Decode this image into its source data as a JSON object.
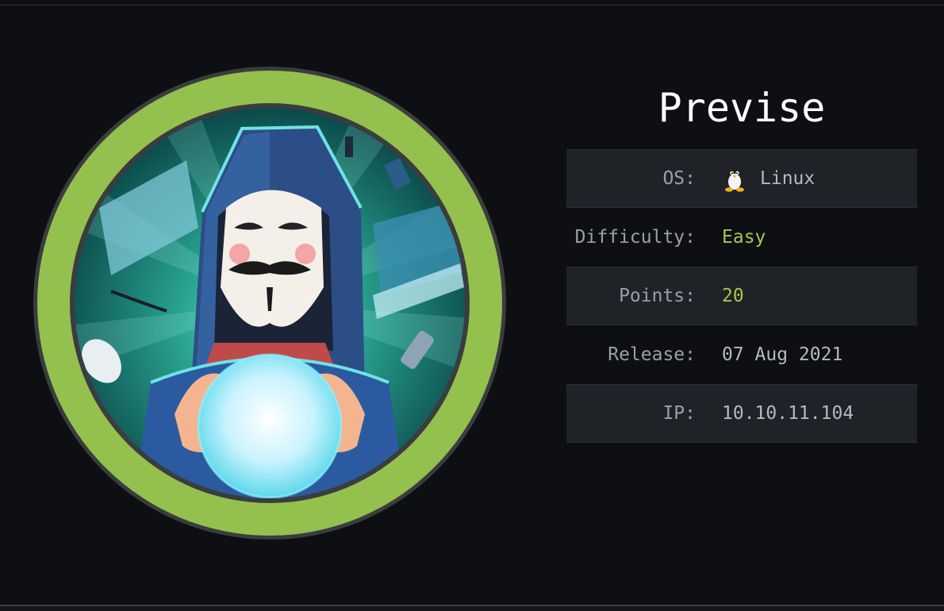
{
  "machine": {
    "name": "Previse",
    "avatar_icon": "hacker-avatar-icon",
    "ring_color": "#94c04e"
  },
  "details": [
    {
      "label": "OS:",
      "value": "Linux",
      "icon": "tux-penguin-icon",
      "accent": false
    },
    {
      "label": "Difficulty:",
      "value": "Easy",
      "accent": true
    },
    {
      "label": "Points:",
      "value": "20",
      "accent": true
    },
    {
      "label": "Release:",
      "value": "07 Aug 2021",
      "accent": false
    },
    {
      "label": "IP:",
      "value": "10.10.11.104",
      "accent": false
    }
  ],
  "colors": {
    "background": "#0d0f13",
    "accent_green": "#a4c84e",
    "row_shade": "#1f2227"
  }
}
